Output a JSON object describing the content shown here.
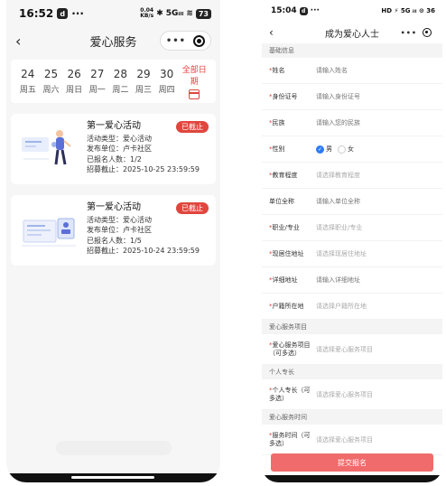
{
  "left": {
    "status": {
      "time": "16:52",
      "app_badge": "d",
      "net_top": "0.04",
      "net_bottom": "KB/s",
      "signal": "5G",
      "battery": "73"
    },
    "nav": {
      "back": "‹",
      "title": "爱心服务",
      "more": "•••"
    },
    "dates": [
      {
        "day": "24",
        "weekday": "周五"
      },
      {
        "day": "25",
        "weekday": "周六"
      },
      {
        "day": "26",
        "weekday": "周日"
      },
      {
        "day": "27",
        "weekday": "周一"
      },
      {
        "day": "28",
        "weekday": "周二"
      },
      {
        "day": "29",
        "weekday": "周三"
      },
      {
        "day": "30",
        "weekday": "周四"
      }
    ],
    "all_dates_label": "全部日期",
    "activities": [
      {
        "title": "第一爱心活动",
        "status": "已截止",
        "type": "活动类型：爱心活动",
        "publisher": "发布单位：卢卡社区",
        "enrolled": "已报名人数：1/2",
        "deadline": "招募截止：2025-10-25 23:59:59"
      },
      {
        "title": "第一爱心活动",
        "status": "已截止",
        "type": "活动类型：爱心活动",
        "publisher": "发布单位：卢卡社区",
        "enrolled": "已报名人数：1/5",
        "deadline": "招募截止：2025-10-24 23:59:59"
      }
    ]
  },
  "right": {
    "status": {
      "time": "15:04",
      "app_badge": "d",
      "indicators": "HD ⚡ 5G ᵢₗₗ ⊙ 36"
    },
    "nav": {
      "back": "‹",
      "title": "成为爱心人士",
      "more": "•••"
    },
    "section_basic": "基础信息",
    "fields": {
      "name": {
        "label": "姓名",
        "placeholder": "请输入姓名"
      },
      "idcard": {
        "label": "身份证号",
        "placeholder": "请输入身份证号"
      },
      "ethnic": {
        "label": "民族",
        "placeholder": "请输入您的民族"
      },
      "gender": {
        "label": "性别",
        "male": "男",
        "female": "女",
        "selected": "男"
      },
      "education": {
        "label": "教育程度",
        "placeholder": "请选择教育程度"
      },
      "org": {
        "label": "单位全称",
        "placeholder": "请输入单位全称"
      },
      "occupation": {
        "label": "职业/专业",
        "placeholder": "请选择职业/专业"
      },
      "address": {
        "label": "现居住地址",
        "placeholder": "请选择现居住地址"
      },
      "detail": {
        "label": "详细地址",
        "placeholder": "请输入详细地址"
      },
      "hukou": {
        "label": "户籍所在地",
        "placeholder": "请选择户籍所在地"
      }
    },
    "section_service": "爱心服务项目",
    "service_item": {
      "label": "爱心服务项目（可多选）",
      "placeholder": "请选择爱心服务项目"
    },
    "section_skill": "个人专长",
    "skill_item": {
      "label": "个人专长（可多选）",
      "placeholder": "请选择爱心服务项目"
    },
    "section_time": "爱心服务时间",
    "time_item": {
      "label": "服务时间（可多选）",
      "placeholder": "请选择爱心服务项目"
    },
    "submit": "提交报名"
  },
  "colors": {
    "accent_red": "#e0463d",
    "submit_red": "#f06b6b",
    "radio_blue": "#2f7bf5"
  }
}
